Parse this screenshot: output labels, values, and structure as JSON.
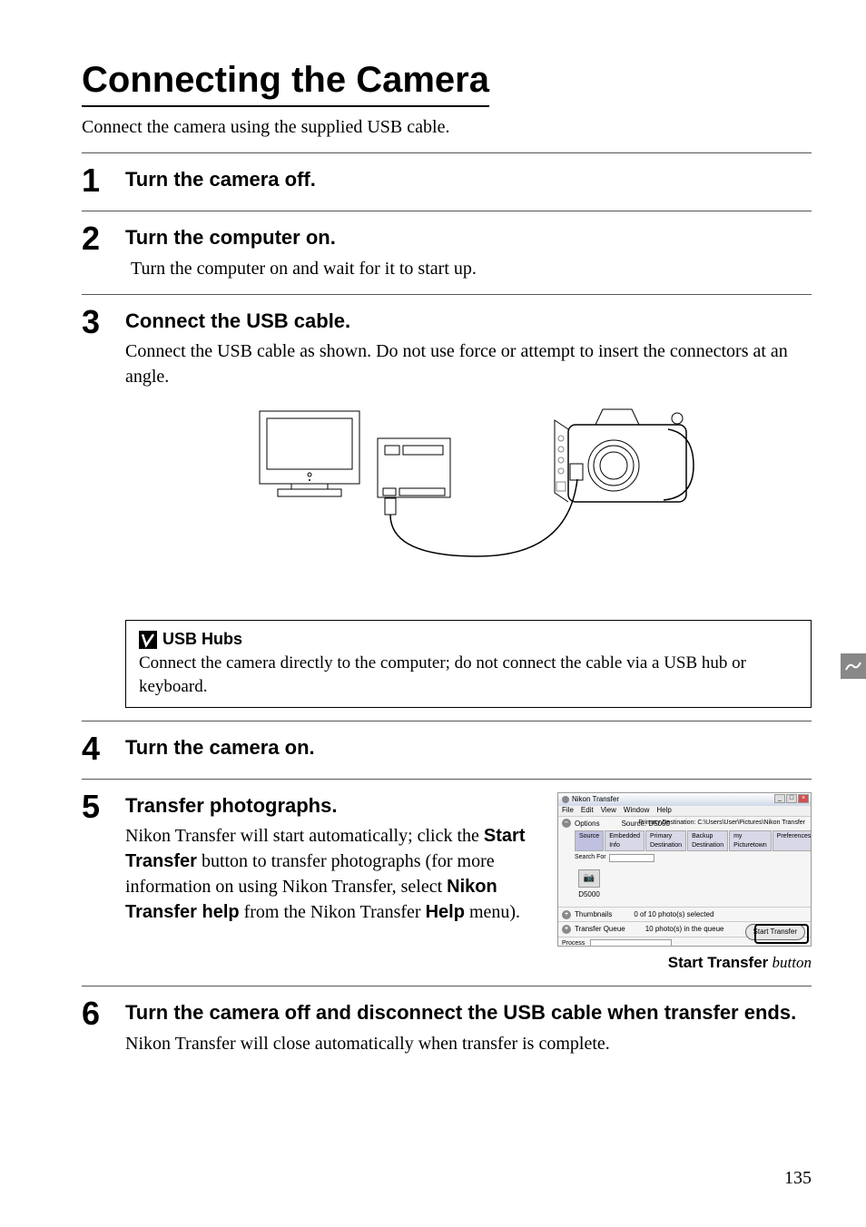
{
  "title": "Connecting the Camera",
  "intro": "Connect the camera using the supplied USB cable.",
  "steps": {
    "s1": {
      "num": "1",
      "heading": "Turn the camera off."
    },
    "s2": {
      "num": "2",
      "heading": "Turn the computer on.",
      "body": "Turn the computer on and wait for it to start up."
    },
    "s3": {
      "num": "3",
      "heading": "Connect the USB cable.",
      "body": "Connect the USB cable as shown.  Do not use force or attempt to insert the connectors at an angle."
    },
    "s4": {
      "num": "4",
      "heading": "Turn the camera on."
    },
    "s5": {
      "num": "5",
      "heading": "Transfer photographs.",
      "body_parts": {
        "p1": "Nikon Transfer will start automatically; click the ",
        "b1": "Start Transfer",
        "p2": " button to transfer photographs (for more information on using Nikon Transfer, select ",
        "b2": "Nikon Transfer help",
        "p3": " from the Nikon Transfer ",
        "b3": "Help",
        "p4": " menu)."
      }
    },
    "s6": {
      "num": "6",
      "heading": "Turn the camera off and disconnect the USB cable when transfer ends.",
      "body": "Nikon Transfer will close automatically when transfer is complete."
    }
  },
  "note": {
    "heading": "USB Hubs",
    "body": "Connect the camera directly to the computer; do not connect the cable via a USB hub or keyboard."
  },
  "screenshot": {
    "window_title": "Nikon Transfer",
    "menu": {
      "file": "File",
      "edit": "Edit",
      "view": "View",
      "window": "Window",
      "help": "Help"
    },
    "options_label": "Options",
    "source_label": "Source: D5000",
    "dest_label": "Primary Destination: C:\\Users\\User\\Pictures\\Nikon Transfer",
    "tabs": {
      "source": "Source",
      "embedded": "Embedded Info",
      "primary": "Primary Destination",
      "backup": "Backup Destination",
      "picturetown": "my Picturetown",
      "preferences": "Preferences"
    },
    "search_label": "Search For",
    "device_name": "D5000",
    "thumbnails_label": "Thumbnails",
    "thumbnails_status": "0 of 10 photo(s) selected",
    "queue_label": "Transfer Queue",
    "queue_status": "10 photo(s) in the queue",
    "process_label": "Process",
    "start_button": "Start Transfer"
  },
  "caption": {
    "bold": "Start Transfer",
    "rest": " button"
  },
  "page_number": "135"
}
